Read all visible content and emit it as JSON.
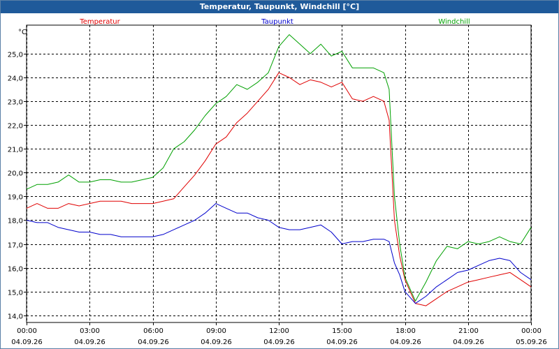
{
  "window": {
    "title": "Temperatur, Taupunkt, Windchill [°C]"
  },
  "chart_data": {
    "type": "line",
    "title": "Temperatur, Taupunkt, Windchill [°C]",
    "ylabel": "°C",
    "ylim": [
      13.7,
      26.2
    ],
    "yticks": [
      14.0,
      15.0,
      16.0,
      17.0,
      18.0,
      19.0,
      20.0,
      21.0,
      22.0,
      23.0,
      24.0,
      25.0
    ],
    "ytick_labels": [
      "14,0",
      "15,0",
      "16,0",
      "17,0",
      "18,0",
      "19,0",
      "20,0",
      "21,0",
      "22,0",
      "23,0",
      "24,0",
      "25,0"
    ],
    "xlim": [
      0,
      24
    ],
    "xticks": [
      0,
      3,
      6,
      9,
      12,
      15,
      18,
      21,
      24
    ],
    "xtick_time_labels": [
      "00:00",
      "03:00",
      "06:00",
      "09:00",
      "12:00",
      "15:00",
      "18:00",
      "21:00",
      "00:00"
    ],
    "xtick_date_labels": [
      "04.09.26",
      "04.09.26",
      "04.09.26",
      "04.09.26",
      "04.09.26",
      "04.09.26",
      "04.09.26",
      "04.09.26",
      "05.09.26"
    ],
    "grid": true,
    "legend_position": "top",
    "x": [
      0,
      0.5,
      1,
      1.5,
      2,
      2.5,
      3,
      3.5,
      4,
      4.5,
      5,
      5.5,
      6,
      6.5,
      7,
      7.5,
      8,
      8.5,
      9,
      9.5,
      10,
      10.5,
      11,
      11.5,
      12,
      12.5,
      13,
      13.5,
      14,
      14.5,
      15,
      15.5,
      16,
      16.5,
      17,
      17.25,
      17.5,
      17.75,
      18,
      18.5,
      19,
      19.5,
      20,
      20.5,
      21,
      21.5,
      22,
      22.5,
      23,
      23.5,
      24
    ],
    "series": [
      {
        "name": "Temperatur",
        "color": "#e00000",
        "values": [
          18.5,
          18.7,
          18.5,
          18.5,
          18.7,
          18.6,
          18.7,
          18.8,
          18.8,
          18.8,
          18.7,
          18.7,
          18.7,
          18.8,
          18.9,
          19.4,
          19.9,
          20.5,
          21.2,
          21.5,
          22.1,
          22.5,
          23.0,
          23.5,
          24.2,
          24.0,
          23.7,
          23.9,
          23.8,
          23.6,
          23.8,
          23.1,
          23.0,
          23.2,
          23.0,
          22.2,
          18.0,
          16.5,
          15.5,
          14.5,
          14.4,
          14.7,
          15.0,
          15.2,
          15.4,
          15.5,
          15.6,
          15.7,
          15.8,
          15.5,
          15.2
        ]
      },
      {
        "name": "Taupunkt",
        "color": "#0000cc",
        "values": [
          18.0,
          17.9,
          17.9,
          17.7,
          17.6,
          17.5,
          17.5,
          17.4,
          17.4,
          17.3,
          17.3,
          17.3,
          17.3,
          17.4,
          17.6,
          17.8,
          18.0,
          18.3,
          18.7,
          18.5,
          18.3,
          18.3,
          18.1,
          18.0,
          17.7,
          17.6,
          17.6,
          17.7,
          17.8,
          17.5,
          17.0,
          17.1,
          17.1,
          17.2,
          17.2,
          17.1,
          16.2,
          15.7,
          15.0,
          14.5,
          14.8,
          15.2,
          15.5,
          15.8,
          15.9,
          16.1,
          16.3,
          16.4,
          16.3,
          15.8,
          15.5
        ]
      },
      {
        "name": "Windchill",
        "color": "#00a000",
        "values": [
          19.3,
          19.5,
          19.5,
          19.6,
          19.9,
          19.6,
          19.6,
          19.7,
          19.7,
          19.6,
          19.6,
          19.7,
          19.8,
          20.2,
          21.0,
          21.3,
          21.8,
          22.4,
          22.9,
          23.2,
          23.7,
          23.5,
          23.8,
          24.2,
          25.3,
          25.8,
          25.4,
          25.0,
          25.4,
          24.9,
          25.1,
          24.4,
          24.4,
          24.4,
          24.2,
          23.5,
          19.0,
          17.0,
          15.6,
          14.6,
          15.4,
          16.3,
          16.9,
          16.8,
          17.1,
          17.0,
          17.1,
          17.3,
          17.1,
          17.0,
          17.7
        ]
      }
    ]
  }
}
